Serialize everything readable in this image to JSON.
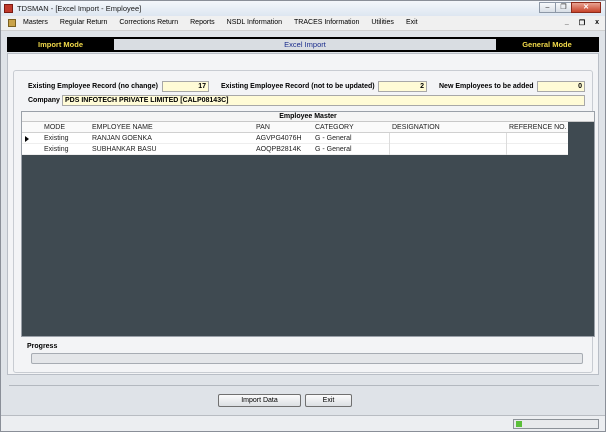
{
  "window": {
    "title": "TDSMAN - [Excel Import - Employee]",
    "minimize": "–",
    "restore": "❐",
    "close": "✕"
  },
  "menu": {
    "items": [
      "Masters",
      "Regular Return",
      "Corrections Return",
      "Reports",
      "NSDL Information",
      "TRACES Information",
      "Utilities",
      "Exit"
    ],
    "mdi_minimize": "_",
    "mdi_restore": "❐",
    "mdi_close": "x"
  },
  "modebar": {
    "left": "Import Mode",
    "center": "Excel Import",
    "right": "General Mode"
  },
  "summary": {
    "existing_no_change_label": "Existing Employee Record (no change)",
    "existing_no_change_value": "17",
    "existing_not_updated_label": "Existing Employee Record (not to be updated)",
    "existing_not_updated_value": "2",
    "new_employees_label": "New Employees to be added",
    "new_employees_value": "0",
    "company_label": "Company",
    "company_value": "PDS INFOTECH PRIVATE LIMITED [CALP08143C]"
  },
  "grid": {
    "caption": "Employee Master",
    "columns": [
      "MODE",
      "EMPLOYEE NAME",
      "PAN",
      "CATEGORY",
      "DESIGNATION",
      "REFERENCE NO."
    ],
    "rows": [
      {
        "mode": "Existing",
        "name": "RANJAN GOENKA",
        "pan": "AGVPG4076H",
        "category": "G - General",
        "designation": "",
        "reference": ""
      },
      {
        "mode": "Existing",
        "name": "SUBHANKAR BASU",
        "pan": "AOQPB2814K",
        "category": "G - General",
        "designation": "",
        "reference": ""
      }
    ]
  },
  "progress": {
    "label": "Progress",
    "fraction": 0
  },
  "buttons": {
    "import": "Import Data",
    "exit": "Exit"
  },
  "colors": {
    "mode_text": "#f1d94a",
    "grid_background": "#3f4a51",
    "field_background": "#fffbd6"
  }
}
